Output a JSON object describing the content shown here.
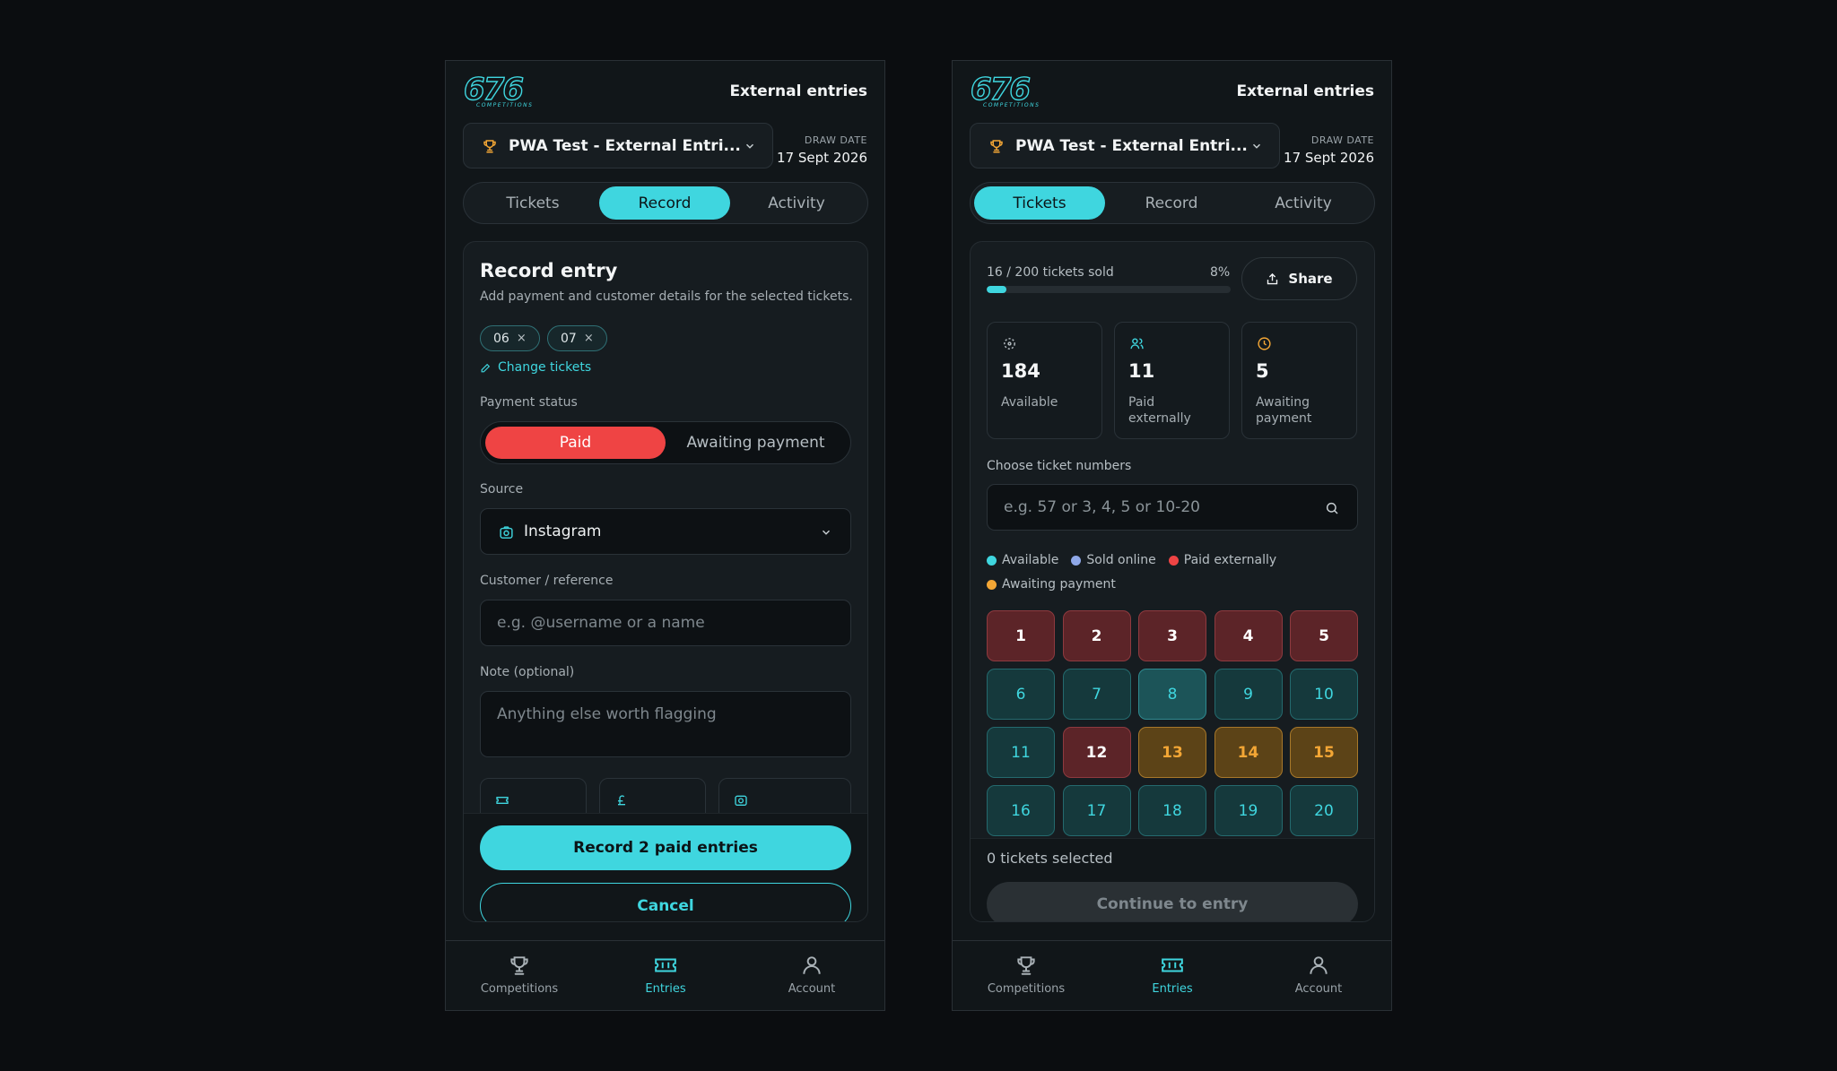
{
  "colors": {
    "accent": "#3fd6df",
    "paid": "#ef4444",
    "awaiting": "#f3a635",
    "sold_online": "#8fa8e8",
    "background": "#0b0d10"
  },
  "brand": {
    "logo_number": "676",
    "logo_subtitle": "COMPETITIONS"
  },
  "screen_title": "External entries",
  "competition": {
    "name": "PWA Test - External Entri...",
    "draw_label": "DRAW DATE",
    "draw_date": "17 Sept 2026"
  },
  "tabs": [
    "Tickets",
    "Record",
    "Activity"
  ],
  "record": {
    "title": "Record entry",
    "subtitle": "Add payment and customer details for the selected tickets.",
    "selected_tickets": [
      "06",
      "07"
    ],
    "chip_remove": "×",
    "change_tickets": "Change tickets",
    "payment_status_label": "Payment status",
    "payment_options": [
      "Paid",
      "Awaiting payment"
    ],
    "selected_payment": "Paid",
    "source_label": "Source",
    "source_value": "Instagram",
    "customer_label": "Customer / reference",
    "customer_placeholder": "e.g. @username or a name",
    "note_label": "Note (optional)",
    "note_placeholder": "Anything else worth flagging",
    "primary_button": "Record 2 paid entries",
    "cancel_button": "Cancel"
  },
  "tickets": {
    "sold_text": "16 / 200 tickets sold",
    "sold_percent": "8%",
    "sold_fraction": 0.08,
    "share": "Share",
    "stats": [
      {
        "value": "184",
        "label": "Available",
        "icon": "spinner-icon"
      },
      {
        "value": "11",
        "label": "Paid externally",
        "icon": "users-icon"
      },
      {
        "value": "5",
        "label": "Awaiting payment",
        "icon": "clock-icon"
      }
    ],
    "choose_label": "Choose ticket numbers",
    "search_placeholder": "e.g. 57 or 3, 4, 5 or 10-20",
    "legend": [
      {
        "label": "Available",
        "color": "#3fd6df"
      },
      {
        "label": "Sold online",
        "color": "#8fa8e8"
      },
      {
        "label": "Paid externally",
        "color": "#ef4444"
      },
      {
        "label": "Awaiting payment",
        "color": "#f3a635"
      }
    ],
    "grid": [
      {
        "n": "1",
        "s": "paid"
      },
      {
        "n": "2",
        "s": "paid"
      },
      {
        "n": "3",
        "s": "paid"
      },
      {
        "n": "4",
        "s": "paid"
      },
      {
        "n": "5",
        "s": "paid"
      },
      {
        "n": "6",
        "s": "avail"
      },
      {
        "n": "7",
        "s": "avail"
      },
      {
        "n": "8",
        "s": "sel"
      },
      {
        "n": "9",
        "s": "avail"
      },
      {
        "n": "10",
        "s": "avail"
      },
      {
        "n": "11",
        "s": "avail"
      },
      {
        "n": "12",
        "s": "paid"
      },
      {
        "n": "13",
        "s": "await"
      },
      {
        "n": "14",
        "s": "await"
      },
      {
        "n": "15",
        "s": "await"
      },
      {
        "n": "16",
        "s": "avail"
      },
      {
        "n": "17",
        "s": "avail"
      },
      {
        "n": "18",
        "s": "avail"
      },
      {
        "n": "19",
        "s": "avail"
      },
      {
        "n": "20",
        "s": "avail"
      }
    ],
    "selected_count": "0 tickets selected",
    "continue_button": "Continue to entry"
  },
  "nav": [
    "Competitions",
    "Entries",
    "Account"
  ]
}
